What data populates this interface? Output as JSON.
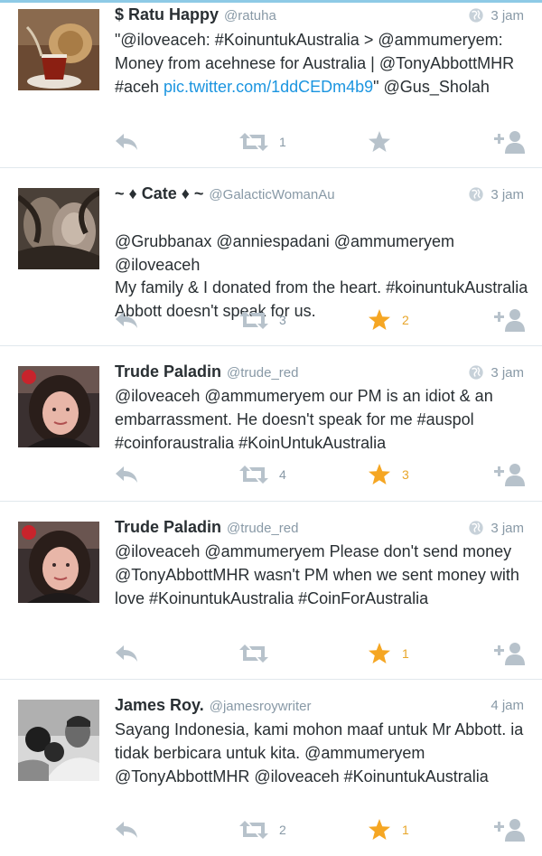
{
  "tweets": [
    {
      "name": "$ Ratu Happy",
      "handle": "@ratuha",
      "time": "3 jam",
      "globe": true,
      "segments": [
        {
          "t": "\"@iloveaceh: #KoinuntukAustralia > @ammumeryem: Money from acehnese for Australia | @TonyAbbottMHR #aceh "
        },
        {
          "t": "pic.twitter.com/1ddCEDm4b9",
          "link": true
        },
        {
          "t": "\" @Gus_Sholah"
        }
      ],
      "retweets": "1",
      "favorites": "",
      "favorited": false
    },
    {
      "name": "~ ♦ Cate ♦ ~",
      "handle": "@GalacticWomanAu",
      "time": "3 jam",
      "globe": true,
      "segments": [
        {
          "t": "@Grubbanax @anniespadani @ammumeryem @iloveaceh\nMy family & I donated from the heart. #koinuntukAustralia Abbott doesn't speak for us."
        }
      ],
      "retweets": "3",
      "favorites": "2",
      "favorited": true
    },
    {
      "name": "Trude Paladin",
      "handle": "@trude_red",
      "time": "3 jam",
      "globe": true,
      "segments": [
        {
          "t": "@iloveaceh @ammumeryem our PM is an idiot & an embarrassment. He doesn't speak for me #auspol #coinforaustralia #KoinUntukAustralia"
        }
      ],
      "retweets": "4",
      "favorites": "3",
      "favorited": true
    },
    {
      "name": "Trude Paladin",
      "handle": "@trude_red",
      "time": "3 jam",
      "globe": true,
      "segments": [
        {
          "t": "@iloveaceh @ammumeryem Please don't send money @TonyAbbottMHR wasn't PM when we sent money with love #KoinuntukAustralia #CoinForAustralia"
        }
      ],
      "retweets": "",
      "favorites": "1",
      "favorited": true
    },
    {
      "name": "James Roy.",
      "handle": "@jamesroywriter",
      "time": "4 jam",
      "globe": false,
      "segments": [
        {
          "t": "Sayang Indonesia, kami mohon maaf untuk Mr Abbott. ia tidak berbicara untuk kita. @ammumeryem @TonyAbbottMHR @iloveaceh #KoinuntukAustralia"
        }
      ],
      "retweets": "2",
      "favorites": "1",
      "favorited": true
    }
  ],
  "colors": {
    "icon_gray": "#b7c2cb",
    "favorite_gold": "#f5a623",
    "link_blue": "#1b95e0"
  },
  "icons": {
    "reply": "reply-icon",
    "retweet": "retweet-icon",
    "favorite": "star-icon",
    "follow": "follow-user-icon",
    "globe": "globe-icon"
  }
}
